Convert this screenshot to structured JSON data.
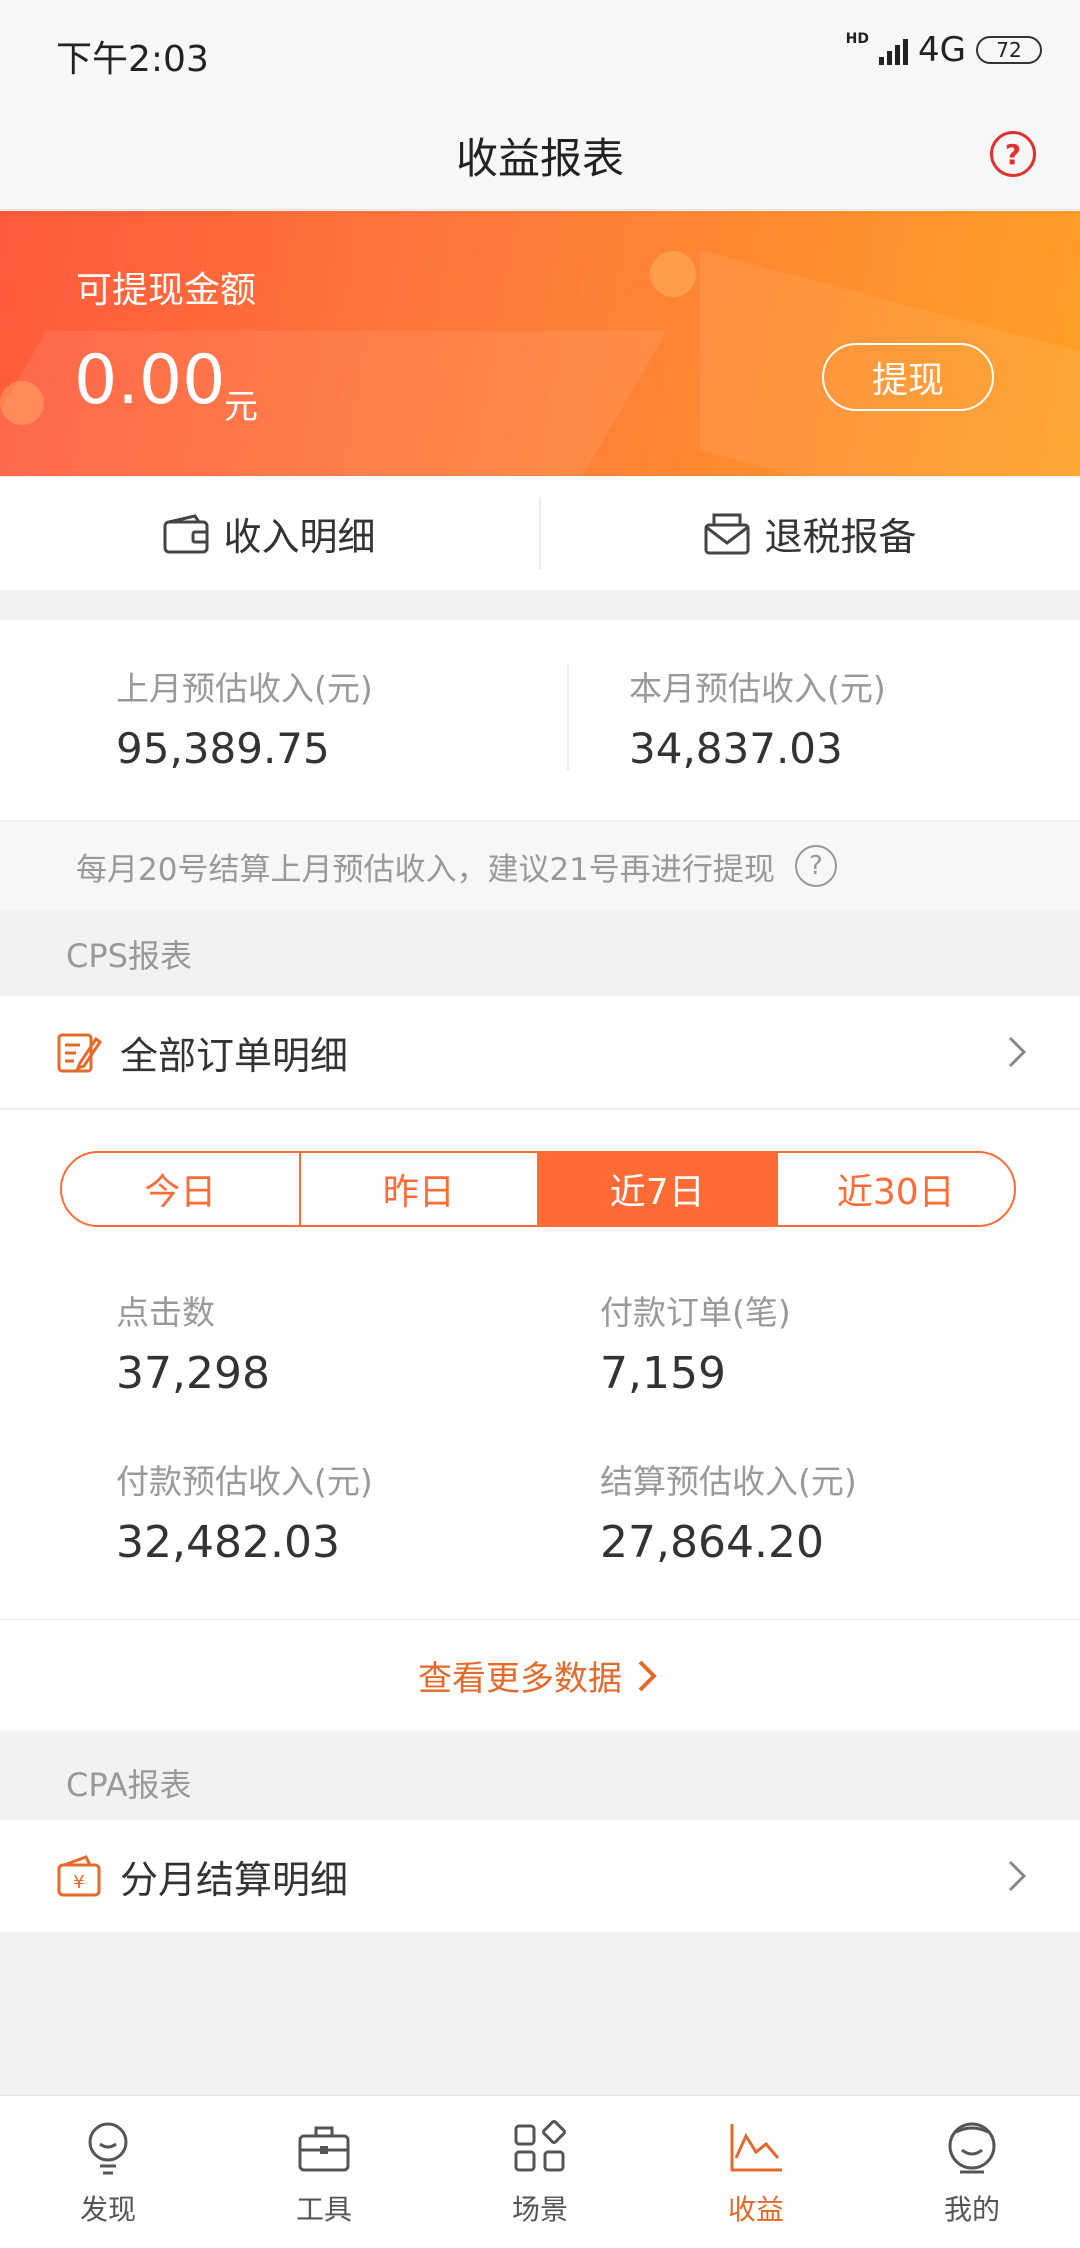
{
  "status": {
    "time": "下午2:03",
    "hd": "HD",
    "network": "4G",
    "battery": "72"
  },
  "header": {
    "title": "收益报表",
    "help": "?"
  },
  "banner": {
    "label": "可提现金额",
    "amount": "0.00",
    "unit": "元",
    "withdraw": "提现"
  },
  "actions": {
    "income_detail": "收入明细",
    "tax_filing": "退税报备"
  },
  "estimate": {
    "last_month_label": "上月预估收入(元)",
    "last_month_value": "95,389.75",
    "this_month_label": "本月预估收入(元)",
    "this_month_value": "34,837.03"
  },
  "notice": {
    "text": "每月20号结算上月预估收入，建议21号再进行提现",
    "help": "?"
  },
  "cps": {
    "section": "CPS报表",
    "orders_link": "全部订单明细",
    "tabs": [
      "今日",
      "昨日",
      "近7日",
      "近30日"
    ],
    "active_tab": "近7日",
    "stats": [
      {
        "label": "点击数",
        "value": "37,298"
      },
      {
        "label": "付款订单(笔)",
        "value": "7,159"
      },
      {
        "label": "付款预估收入(元)",
        "value": "32,482.03"
      },
      {
        "label": "结算预估收入(元)",
        "value": "27,864.20"
      }
    ],
    "more": "查看更多数据"
  },
  "cpa": {
    "section": "CPA报表",
    "monthly_link": "分月结算明细"
  },
  "nav": {
    "items": [
      "发现",
      "工具",
      "场景",
      "收益",
      "我的"
    ],
    "active": "收益"
  },
  "colors": {
    "accent": "#ff6b35",
    "link": "#e46a2a",
    "alert": "#e03030"
  }
}
